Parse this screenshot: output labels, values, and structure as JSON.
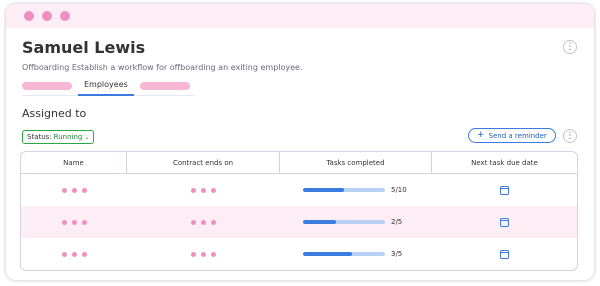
{
  "window": {
    "traffic_lights": [
      "#ef8fbf",
      "#ef8fbf",
      "#ef8fbf"
    ]
  },
  "header": {
    "title": "Samuel Lewis",
    "subtitle": "Offboarding Establish a workflow for offboarding an exiting employee.",
    "menu_icon": "kebab-icon"
  },
  "tabs": {
    "active_label": "Employees"
  },
  "section": {
    "title": "Assigned to"
  },
  "filter": {
    "label": "Status:",
    "value": "Running"
  },
  "actions": {
    "send_reminder": "Send a reminder"
  },
  "table": {
    "columns": [
      "Name",
      "Contract ends on",
      "Tasks completed",
      "Next task due date"
    ],
    "rows": [
      {
        "completed": 5,
        "total": 10,
        "text": "5/10",
        "progress": 0.5
      },
      {
        "completed": 2,
        "total": 5,
        "text": "2/5",
        "progress": 0.4
      },
      {
        "completed": 3,
        "total": 5,
        "text": "3/5",
        "progress": 0.6
      }
    ]
  },
  "colors": {
    "accent": "#3c7be0",
    "pink": "#ef8fbf",
    "status_green": "#28a745"
  }
}
